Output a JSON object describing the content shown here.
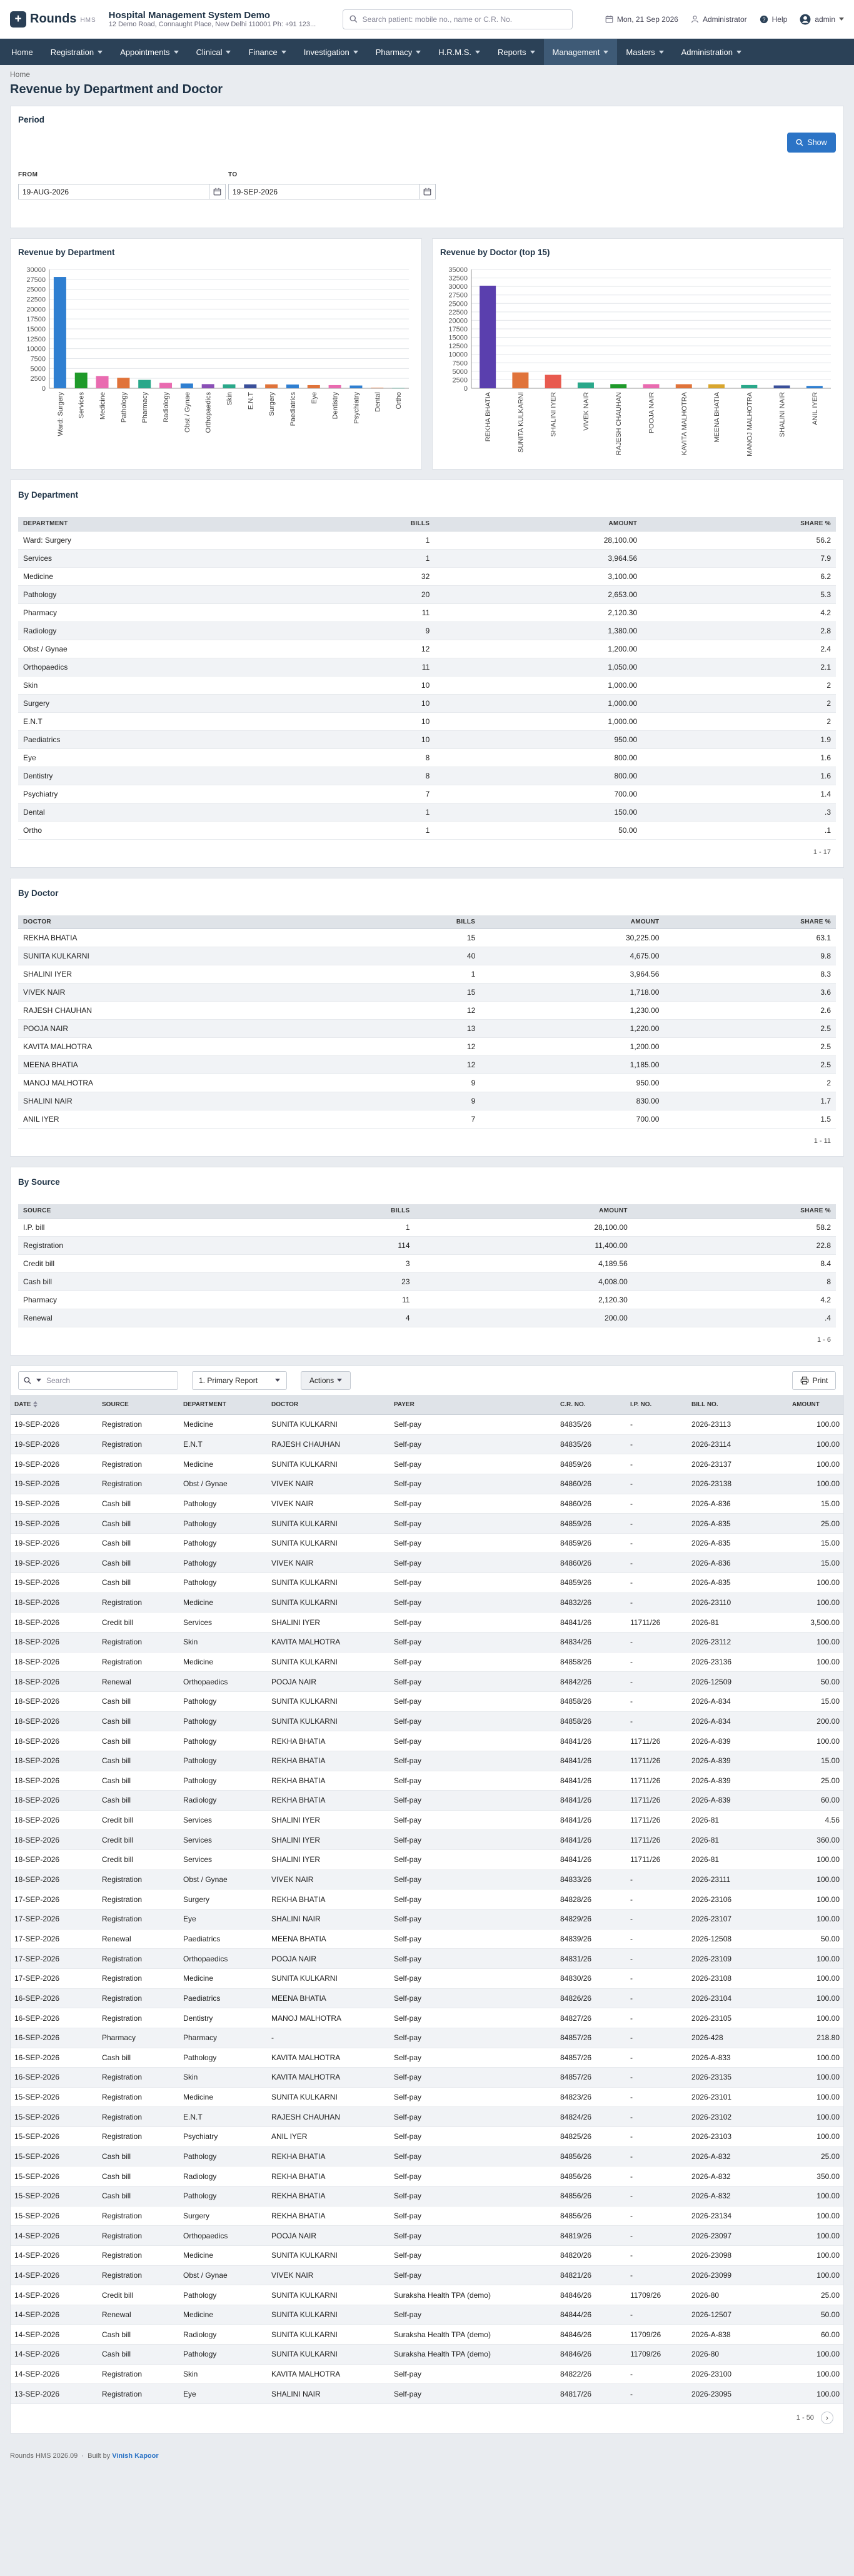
{
  "app": {
    "logo_letter": "+",
    "name": "Rounds",
    "suffix": "HMS",
    "hospital_name": "Hospital Management System Demo",
    "hospital_address": "12 Demo Road, Connaught Place, New Delhi 110001 Ph: +91 123..."
  },
  "search": {
    "placeholder": "Search patient: mobile no., name or C.R. No."
  },
  "top": {
    "date": "Mon, 21 Sep 2026",
    "role": "Administrator",
    "help": "Help",
    "user": "admin"
  },
  "nav": [
    {
      "label": "Home",
      "dropdown": false,
      "active": false
    },
    {
      "label": "Registration",
      "dropdown": true,
      "active": false
    },
    {
      "label": "Appointments",
      "dropdown": true,
      "active": false
    },
    {
      "label": "Clinical",
      "dropdown": true,
      "active": false
    },
    {
      "label": "Finance",
      "dropdown": true,
      "active": false
    },
    {
      "label": "Investigation",
      "dropdown": true,
      "active": false
    },
    {
      "label": "Pharmacy",
      "dropdown": true,
      "active": false
    },
    {
      "label": "H.R.M.S.",
      "dropdown": true,
      "active": false
    },
    {
      "label": "Reports",
      "dropdown": true,
      "active": false
    },
    {
      "label": "Management",
      "dropdown": true,
      "active": true
    },
    {
      "label": "Masters",
      "dropdown": true,
      "active": false
    },
    {
      "label": "Administration",
      "dropdown": true,
      "active": false
    }
  ],
  "breadcrumb": "Home",
  "page_title": "Revenue by Department and Doctor",
  "period": {
    "title": "Period",
    "show_label": "Show",
    "from_label": "FROM",
    "from_value": "19-AUG-2026",
    "to_label": "TO",
    "to_value": "19-SEP-2026"
  },
  "chart_data": [
    {
      "type": "bar",
      "title": "Revenue by Department",
      "categories": [
        "Ward: Surgery",
        "Services",
        "Medicine",
        "Pathology",
        "Pharmacy",
        "Radiology",
        "Obst / Gynae",
        "Orthopaedics",
        "Skin",
        "E.N.T",
        "Surgery",
        "Paediatrics",
        "Eye",
        "Dentistry",
        "Psychiatry",
        "Dental",
        "Ortho"
      ],
      "values": [
        28100,
        3964.56,
        3100,
        2653,
        2120.3,
        1380,
        1200,
        1050,
        1000,
        1000,
        1000,
        950,
        800,
        800,
        700,
        150,
        50
      ],
      "colors": [
        "#2f7fd1",
        "#1f9a2a",
        "#e96bb0",
        "#e0733a",
        "#2aa88a",
        "#e96bb0",
        "#2f7fd1",
        "#8a4fb6",
        "#2aa88a",
        "#3a4f9a",
        "#e0733a",
        "#2f7fd1",
        "#e0733a",
        "#e96bb0",
        "#2f7fd1",
        "#e0733a",
        "#2aa88a"
      ],
      "yticks": [
        0,
        2500,
        5000,
        7500,
        10000,
        12500,
        15000,
        17500,
        20000,
        22500,
        25000,
        27500,
        30000
      ],
      "ylim": [
        0,
        30000
      ],
      "grid": true
    },
    {
      "type": "bar",
      "title": "Revenue by Doctor (top 15)",
      "categories": [
        "REKHA BHATIA",
        "SUNITA KULKARNI",
        "SHALINI IYER",
        "VIVEK NAIR",
        "RAJESH CHAUHAN",
        "POOJA NAIR",
        "KAVITA MALHOTRA",
        "MEENA BHATIA",
        "MANOJ MALHOTRA",
        "SHALINI NAIR",
        "ANIL IYER"
      ],
      "values": [
        30225,
        4675,
        3964.56,
        1718,
        1230,
        1220,
        1200,
        1185,
        950,
        830,
        700
      ],
      "colors": [
        "#5a3fae",
        "#e0733a",
        "#e85a4f",
        "#2aa88a",
        "#1f9a2a",
        "#e96bb0",
        "#e0733a",
        "#d9a62e",
        "#2aa88a",
        "#3a4f9a",
        "#2f7fd1"
      ],
      "yticks": [
        0,
        2500,
        5000,
        7500,
        10000,
        12500,
        15000,
        17500,
        20000,
        22500,
        25000,
        27500,
        30000,
        32500,
        35000
      ],
      "ylim": [
        0,
        35000
      ],
      "grid": true
    }
  ],
  "by_department": {
    "title": "By Department",
    "headers": [
      "DEPARTMENT",
      "BILLS",
      "AMOUNT",
      "SHARE %"
    ],
    "rows": [
      [
        "Ward: Surgery",
        "1",
        "28,100.00",
        "56.2"
      ],
      [
        "Services",
        "1",
        "3,964.56",
        "7.9"
      ],
      [
        "Medicine",
        "32",
        "3,100.00",
        "6.2"
      ],
      [
        "Pathology",
        "20",
        "2,653.00",
        "5.3"
      ],
      [
        "Pharmacy",
        "11",
        "2,120.30",
        "4.2"
      ],
      [
        "Radiology",
        "9",
        "1,380.00",
        "2.8"
      ],
      [
        "Obst / Gynae",
        "12",
        "1,200.00",
        "2.4"
      ],
      [
        "Orthopaedics",
        "11",
        "1,050.00",
        "2.1"
      ],
      [
        "Skin",
        "10",
        "1,000.00",
        "2"
      ],
      [
        "Surgery",
        "10",
        "1,000.00",
        "2"
      ],
      [
        "E.N.T",
        "10",
        "1,000.00",
        "2"
      ],
      [
        "Paediatrics",
        "10",
        "950.00",
        "1.9"
      ],
      [
        "Eye",
        "8",
        "800.00",
        "1.6"
      ],
      [
        "Dentistry",
        "8",
        "800.00",
        "1.6"
      ],
      [
        "Psychiatry",
        "7",
        "700.00",
        "1.4"
      ],
      [
        "Dental",
        "1",
        "150.00",
        ".3"
      ],
      [
        "Ortho",
        "1",
        "50.00",
        ".1"
      ]
    ],
    "pager": "1 - 17"
  },
  "by_doctor": {
    "title": "By Doctor",
    "headers": [
      "DOCTOR",
      "BILLS",
      "AMOUNT",
      "SHARE %"
    ],
    "rows": [
      [
        "REKHA BHATIA",
        "15",
        "30,225.00",
        "63.1"
      ],
      [
        "SUNITA KULKARNI",
        "40",
        "4,675.00",
        "9.8"
      ],
      [
        "SHALINI IYER",
        "1",
        "3,964.56",
        "8.3"
      ],
      [
        "VIVEK NAIR",
        "15",
        "1,718.00",
        "3.6"
      ],
      [
        "RAJESH CHAUHAN",
        "12",
        "1,230.00",
        "2.6"
      ],
      [
        "POOJA NAIR",
        "13",
        "1,220.00",
        "2.5"
      ],
      [
        "KAVITA MALHOTRA",
        "12",
        "1,200.00",
        "2.5"
      ],
      [
        "MEENA BHATIA",
        "12",
        "1,185.00",
        "2.5"
      ],
      [
        "MANOJ MALHOTRA",
        "9",
        "950.00",
        "2"
      ],
      [
        "SHALINI NAIR",
        "9",
        "830.00",
        "1.7"
      ],
      [
        "ANIL IYER",
        "7",
        "700.00",
        "1.5"
      ]
    ],
    "pager": "1 - 11"
  },
  "by_source": {
    "title": "By Source",
    "headers": [
      "SOURCE",
      "BILLS",
      "AMOUNT",
      "SHARE %"
    ],
    "rows": [
      [
        "I.P. bill",
        "1",
        "28,100.00",
        "58.2"
      ],
      [
        "Registration",
        "114",
        "11,400.00",
        "22.8"
      ],
      [
        "Credit bill",
        "3",
        "4,189.56",
        "8.4"
      ],
      [
        "Cash bill",
        "23",
        "4,008.00",
        "8"
      ],
      [
        "Pharmacy",
        "11",
        "2,120.30",
        "4.2"
      ],
      [
        "Renewal",
        "4",
        "200.00",
        ".4"
      ]
    ],
    "pager": "1 - 6"
  },
  "detail": {
    "search_placeholder": "Search",
    "report_select": "1. Primary Report",
    "actions_label": "Actions",
    "print_label": "Print",
    "headers": [
      "DATE",
      "SOURCE",
      "DEPARTMENT",
      "DOCTOR",
      "PAYER",
      "C.R. NO.",
      "I.P. NO.",
      "BILL NO.",
      "AMOUNT"
    ],
    "rows": [
      [
        "19-SEP-2026",
        "Registration",
        "Medicine",
        "SUNITA KULKARNI",
        "Self-pay",
        "84835/26",
        "-",
        "2026-23113",
        "100.00"
      ],
      [
        "19-SEP-2026",
        "Registration",
        "E.N.T",
        "RAJESH CHAUHAN",
        "Self-pay",
        "84835/26",
        "-",
        "2026-23114",
        "100.00"
      ],
      [
        "19-SEP-2026",
        "Registration",
        "Medicine",
        "SUNITA KULKARNI",
        "Self-pay",
        "84859/26",
        "-",
        "2026-23137",
        "100.00"
      ],
      [
        "19-SEP-2026",
        "Registration",
        "Obst / Gynae",
        "VIVEK NAIR",
        "Self-pay",
        "84860/26",
        "-",
        "2026-23138",
        "100.00"
      ],
      [
        "19-SEP-2026",
        "Cash bill",
        "Pathology",
        "VIVEK NAIR",
        "Self-pay",
        "84860/26",
        "-",
        "2026-A-836",
        "15.00"
      ],
      [
        "19-SEP-2026",
        "Cash bill",
        "Pathology",
        "SUNITA KULKARNI",
        "Self-pay",
        "84859/26",
        "-",
        "2026-A-835",
        "25.00"
      ],
      [
        "19-SEP-2026",
        "Cash bill",
        "Pathology",
        "SUNITA KULKARNI",
        "Self-pay",
        "84859/26",
        "-",
        "2026-A-835",
        "15.00"
      ],
      [
        "19-SEP-2026",
        "Cash bill",
        "Pathology",
        "VIVEK NAIR",
        "Self-pay",
        "84860/26",
        "-",
        "2026-A-836",
        "15.00"
      ],
      [
        "19-SEP-2026",
        "Cash bill",
        "Pathology",
        "SUNITA KULKARNI",
        "Self-pay",
        "84859/26",
        "-",
        "2026-A-835",
        "100.00"
      ],
      [
        "18-SEP-2026",
        "Registration",
        "Medicine",
        "SUNITA KULKARNI",
        "Self-pay",
        "84832/26",
        "-",
        "2026-23110",
        "100.00"
      ],
      [
        "18-SEP-2026",
        "Credit bill",
        "Services",
        "SHALINI IYER",
        "Self-pay",
        "84841/26",
        "11711/26",
        "2026-81",
        "3,500.00"
      ],
      [
        "18-SEP-2026",
        "Registration",
        "Skin",
        "KAVITA MALHOTRA",
        "Self-pay",
        "84834/26",
        "-",
        "2026-23112",
        "100.00"
      ],
      [
        "18-SEP-2026",
        "Registration",
        "Medicine",
        "SUNITA KULKARNI",
        "Self-pay",
        "84858/26",
        "-",
        "2026-23136",
        "100.00"
      ],
      [
        "18-SEP-2026",
        "Renewal",
        "Orthopaedics",
        "POOJA NAIR",
        "Self-pay",
        "84842/26",
        "-",
        "2026-12509",
        "50.00"
      ],
      [
        "18-SEP-2026",
        "Cash bill",
        "Pathology",
        "SUNITA KULKARNI",
        "Self-pay",
        "84858/26",
        "-",
        "2026-A-834",
        "15.00"
      ],
      [
        "18-SEP-2026",
        "Cash bill",
        "Pathology",
        "SUNITA KULKARNI",
        "Self-pay",
        "84858/26",
        "-",
        "2026-A-834",
        "200.00"
      ],
      [
        "18-SEP-2026",
        "Cash bill",
        "Pathology",
        "REKHA BHATIA",
        "Self-pay",
        "84841/26",
        "11711/26",
        "2026-A-839",
        "100.00"
      ],
      [
        "18-SEP-2026",
        "Cash bill",
        "Pathology",
        "REKHA BHATIA",
        "Self-pay",
        "84841/26",
        "11711/26",
        "2026-A-839",
        "15.00"
      ],
      [
        "18-SEP-2026",
        "Cash bill",
        "Pathology",
        "REKHA BHATIA",
        "Self-pay",
        "84841/26",
        "11711/26",
        "2026-A-839",
        "25.00"
      ],
      [
        "18-SEP-2026",
        "Cash bill",
        "Radiology",
        "REKHA BHATIA",
        "Self-pay",
        "84841/26",
        "11711/26",
        "2026-A-839",
        "60.00"
      ],
      [
        "18-SEP-2026",
        "Credit bill",
        "Services",
        "SHALINI IYER",
        "Self-pay",
        "84841/26",
        "11711/26",
        "2026-81",
        "4.56"
      ],
      [
        "18-SEP-2026",
        "Credit bill",
        "Services",
        "SHALINI IYER",
        "Self-pay",
        "84841/26",
        "11711/26",
        "2026-81",
        "360.00"
      ],
      [
        "18-SEP-2026",
        "Credit bill",
        "Services",
        "SHALINI IYER",
        "Self-pay",
        "84841/26",
        "11711/26",
        "2026-81",
        "100.00"
      ],
      [
        "18-SEP-2026",
        "Registration",
        "Obst / Gynae",
        "VIVEK NAIR",
        "Self-pay",
        "84833/26",
        "-",
        "2026-23111",
        "100.00"
      ],
      [
        "17-SEP-2026",
        "Registration",
        "Surgery",
        "REKHA BHATIA",
        "Self-pay",
        "84828/26",
        "-",
        "2026-23106",
        "100.00"
      ],
      [
        "17-SEP-2026",
        "Registration",
        "Eye",
        "SHALINI NAIR",
        "Self-pay",
        "84829/26",
        "-",
        "2026-23107",
        "100.00"
      ],
      [
        "17-SEP-2026",
        "Renewal",
        "Paediatrics",
        "MEENA BHATIA",
        "Self-pay",
        "84839/26",
        "-",
        "2026-12508",
        "50.00"
      ],
      [
        "17-SEP-2026",
        "Registration",
        "Orthopaedics",
        "POOJA NAIR",
        "Self-pay",
        "84831/26",
        "-",
        "2026-23109",
        "100.00"
      ],
      [
        "17-SEP-2026",
        "Registration",
        "Medicine",
        "SUNITA KULKARNI",
        "Self-pay",
        "84830/26",
        "-",
        "2026-23108",
        "100.00"
      ],
      [
        "16-SEP-2026",
        "Registration",
        "Paediatrics",
        "MEENA BHATIA",
        "Self-pay",
        "84826/26",
        "-",
        "2026-23104",
        "100.00"
      ],
      [
        "16-SEP-2026",
        "Registration",
        "Dentistry",
        "MANOJ MALHOTRA",
        "Self-pay",
        "84827/26",
        "-",
        "2026-23105",
        "100.00"
      ],
      [
        "16-SEP-2026",
        "Pharmacy",
        "Pharmacy",
        "-",
        "Self-pay",
        "84857/26",
        "-",
        "2026-428",
        "218.80"
      ],
      [
        "16-SEP-2026",
        "Cash bill",
        "Pathology",
        "KAVITA MALHOTRA",
        "Self-pay",
        "84857/26",
        "-",
        "2026-A-833",
        "100.00"
      ],
      [
        "16-SEP-2026",
        "Registration",
        "Skin",
        "KAVITA MALHOTRA",
        "Self-pay",
        "84857/26",
        "-",
        "2026-23135",
        "100.00"
      ],
      [
        "15-SEP-2026",
        "Registration",
        "Medicine",
        "SUNITA KULKARNI",
        "Self-pay",
        "84823/26",
        "-",
        "2026-23101",
        "100.00"
      ],
      [
        "15-SEP-2026",
        "Registration",
        "E.N.T",
        "RAJESH CHAUHAN",
        "Self-pay",
        "84824/26",
        "-",
        "2026-23102",
        "100.00"
      ],
      [
        "15-SEP-2026",
        "Registration",
        "Psychiatry",
        "ANIL IYER",
        "Self-pay",
        "84825/26",
        "-",
        "2026-23103",
        "100.00"
      ],
      [
        "15-SEP-2026",
        "Cash bill",
        "Pathology",
        "REKHA BHATIA",
        "Self-pay",
        "84856/26",
        "-",
        "2026-A-832",
        "25.00"
      ],
      [
        "15-SEP-2026",
        "Cash bill",
        "Radiology",
        "REKHA BHATIA",
        "Self-pay",
        "84856/26",
        "-",
        "2026-A-832",
        "350.00"
      ],
      [
        "15-SEP-2026",
        "Cash bill",
        "Pathology",
        "REKHA BHATIA",
        "Self-pay",
        "84856/26",
        "-",
        "2026-A-832",
        "100.00"
      ],
      [
        "15-SEP-2026",
        "Registration",
        "Surgery",
        "REKHA BHATIA",
        "Self-pay",
        "84856/26",
        "-",
        "2026-23134",
        "100.00"
      ],
      [
        "14-SEP-2026",
        "Registration",
        "Orthopaedics",
        "POOJA NAIR",
        "Self-pay",
        "84819/26",
        "-",
        "2026-23097",
        "100.00"
      ],
      [
        "14-SEP-2026",
        "Registration",
        "Medicine",
        "SUNITA KULKARNI",
        "Self-pay",
        "84820/26",
        "-",
        "2026-23098",
        "100.00"
      ],
      [
        "14-SEP-2026",
        "Registration",
        "Obst / Gynae",
        "VIVEK NAIR",
        "Self-pay",
        "84821/26",
        "-",
        "2026-23099",
        "100.00"
      ],
      [
        "14-SEP-2026",
        "Credit bill",
        "Pathology",
        "SUNITA KULKARNI",
        "Suraksha Health TPA (demo)",
        "84846/26",
        "11709/26",
        "2026-80",
        "25.00"
      ],
      [
        "14-SEP-2026",
        "Renewal",
        "Medicine",
        "SUNITA KULKARNI",
        "Self-pay",
        "84844/26",
        "-",
        "2026-12507",
        "50.00"
      ],
      [
        "14-SEP-2026",
        "Cash bill",
        "Radiology",
        "SUNITA KULKARNI",
        "Suraksha Health TPA (demo)",
        "84846/26",
        "11709/26",
        "2026-A-838",
        "60.00"
      ],
      [
        "14-SEP-2026",
        "Cash bill",
        "Pathology",
        "SUNITA KULKARNI",
        "Suraksha Health TPA (demo)",
        "84846/26",
        "11709/26",
        "2026-80",
        "100.00"
      ],
      [
        "14-SEP-2026",
        "Registration",
        "Skin",
        "KAVITA MALHOTRA",
        "Self-pay",
        "84822/26",
        "-",
        "2026-23100",
        "100.00"
      ],
      [
        "13-SEP-2026",
        "Registration",
        "Eye",
        "SHALINI NAIR",
        "Self-pay",
        "84817/26",
        "-",
        "2026-23095",
        "100.00"
      ]
    ],
    "pager": "1 - 50"
  },
  "footer": {
    "version": "Rounds HMS 2026.09",
    "built_by": "Built by",
    "author": "Vinish Kapoor"
  }
}
